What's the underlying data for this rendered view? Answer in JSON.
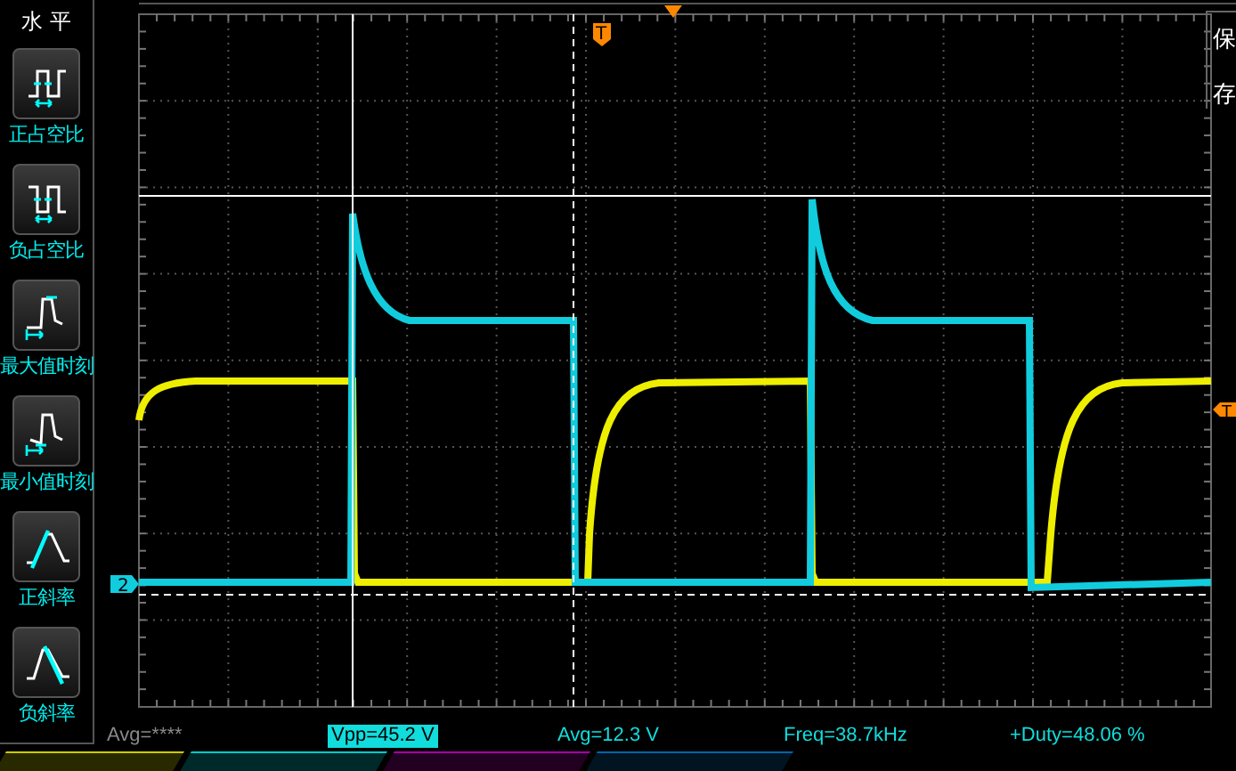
{
  "horizontal_panel": {
    "title": "水 平",
    "items": [
      {
        "label": "正占空比",
        "kind": "positive_duty"
      },
      {
        "label": "负占空比",
        "kind": "negative_duty"
      },
      {
        "label": "最大值时刻",
        "kind": "max_time"
      },
      {
        "label": "最小值时刻",
        "kind": "min_time"
      },
      {
        "label": "正斜率",
        "kind": "rise_slope"
      },
      {
        "label": "负斜率",
        "kind": "fall_slope"
      }
    ]
  },
  "side_menu": {
    "items": [
      "保",
      "存"
    ]
  },
  "display": {
    "channel_marker": "2",
    "trigger_marker_top": "T",
    "trigger_marker_right": "T"
  },
  "measurements": [
    {
      "text": "Avg=****",
      "selected": false,
      "disabled": true
    },
    {
      "text": "Vpp=45.2 V",
      "selected": true,
      "disabled": false
    },
    {
      "text": "Avg=12.3 V",
      "selected": false,
      "disabled": false
    },
    {
      "text": "Freq=38.7kHz",
      "selected": false,
      "disabled": false
    },
    {
      "text": "+Duty=48.06 %",
      "selected": false,
      "disabled": false
    }
  ]
}
